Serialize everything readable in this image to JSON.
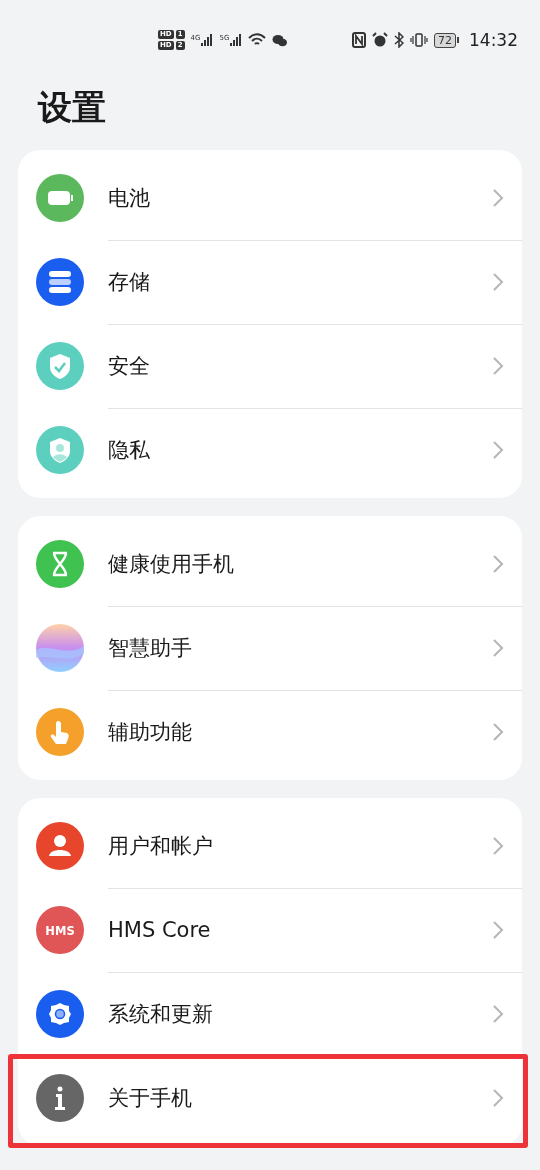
{
  "status_bar": {
    "sims": [
      {
        "hd": "HD",
        "slot": "1"
      },
      {
        "hd": "HD",
        "slot": "2"
      }
    ],
    "networks": [
      "4G",
      "5G"
    ],
    "battery": "72",
    "time": "14:32"
  },
  "title": "设置",
  "groups": [
    {
      "items": [
        {
          "label": "电池",
          "kind": "battery",
          "highlighted": false
        },
        {
          "label": "存储",
          "kind": "storage",
          "highlighted": false
        },
        {
          "label": "安全",
          "kind": "security",
          "highlighted": false
        },
        {
          "label": "隐私",
          "kind": "privacy",
          "highlighted": false
        }
      ]
    },
    {
      "items": [
        {
          "label": "健康使用手机",
          "kind": "hourglass",
          "highlighted": false
        },
        {
          "label": "智慧助手",
          "kind": "assistant",
          "highlighted": false
        },
        {
          "label": "辅助功能",
          "kind": "accessibility",
          "highlighted": false
        }
      ]
    },
    {
      "items": [
        {
          "label": "用户和帐户",
          "kind": "user",
          "highlighted": false
        },
        {
          "label": "HMS Core",
          "kind": "hms",
          "icon_text": "HMS",
          "highlighted": false
        },
        {
          "label": "系统和更新",
          "kind": "gear",
          "highlighted": false
        },
        {
          "label": "关于手机",
          "kind": "info",
          "highlighted": true
        }
      ]
    }
  ]
}
